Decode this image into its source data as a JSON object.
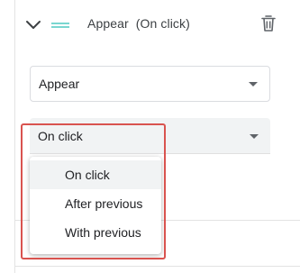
{
  "animation": {
    "effect": "Appear",
    "trigger": "On click"
  },
  "effect_select": {
    "value": "Appear"
  },
  "trigger_select": {
    "value": "On click",
    "options": [
      "On click",
      "After previous",
      "With previous"
    ],
    "selected_index": 0
  },
  "colors": {
    "highlight_border": "#d9534f",
    "animation_icon": "#4ec9c0",
    "menu_selected_bg": "#f1f3f4"
  },
  "icons": {
    "collapse": "chevron-down-icon",
    "animation": "animation-lines-icon",
    "delete": "trash-icon",
    "dropdown": "caret-down-icon"
  }
}
